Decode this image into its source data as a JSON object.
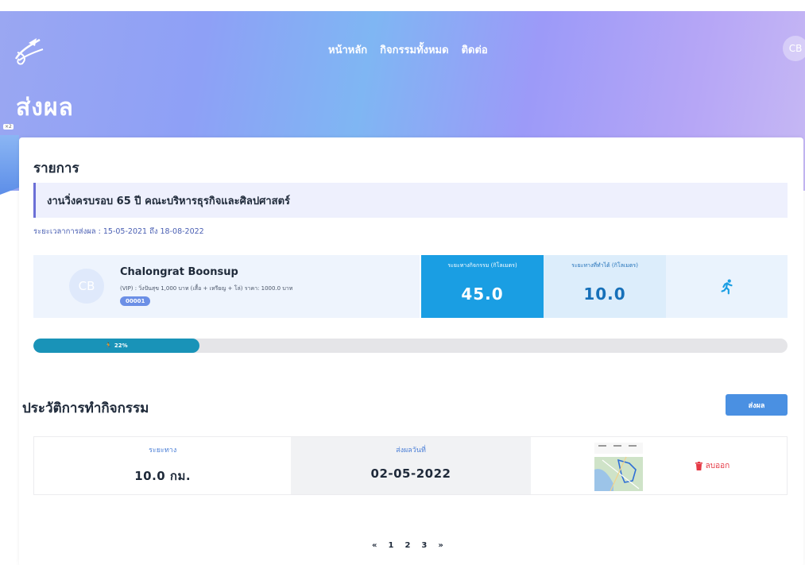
{
  "header": {
    "nav": [
      "หน้าหลัก",
      "กิจกรรมทั้งหมด",
      "ติดต่อ"
    ],
    "user_initials": "CB",
    "page_title": "ส่งผล",
    "version_tag": "×2"
  },
  "event": {
    "section_title": "รายการ",
    "name": "งานวิ่งครบรอบ 65 ปี คณะบริหารธุรกิจและศิลปศาสตร์",
    "period": "ระยะเวลาการส่งผล : 15-05-2021 ถึง 18-08-2022"
  },
  "runner": {
    "initials": "CB",
    "name": "Chalongrat Boonsup",
    "detail": "(VIP) : วิ่งปันสุข 1,000 บาท (เสื้อ + เหรียญ + โล่) ราคา: 1000.0 บาท",
    "bib": "00001"
  },
  "stats": {
    "activity_label": "ระยะทางกิจกรรม (กิโลเมตร)",
    "activity_value": "45.0",
    "done_label": "ระยะทางที่ทำได้ (กิโลเมตร)",
    "done_value": "10.0",
    "icon": "running-icon"
  },
  "progress": {
    "percent": 22,
    "label": "22%",
    "icon": "running-icon"
  },
  "history": {
    "title": "ประวัติการทำกิจกรรม",
    "submit_label": "ส่งผล",
    "rows": [
      {
        "distance_label": "ระยะทาง",
        "distance_value": "10.0 กม.",
        "date_label": "ส่งผลวันที่",
        "date_value": "02-05-2022",
        "delete_label": "ลบออก"
      }
    ]
  },
  "pagination": {
    "prev": "«",
    "pages": [
      "1",
      "2",
      "3"
    ],
    "next": "»"
  },
  "colors": {
    "primary": "#1a9ee3",
    "progress": "#1993b8",
    "danger": "#e53945",
    "button": "#4a90e2"
  }
}
